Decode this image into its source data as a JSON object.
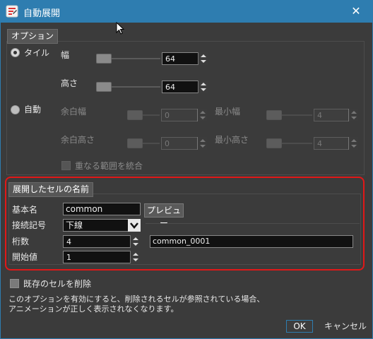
{
  "window": {
    "title": "自動展開",
    "close_glyph": "✕"
  },
  "options": {
    "section_label": "オプション",
    "tile": {
      "radio_label": "タイル",
      "width_label": "幅",
      "width_value": "64",
      "height_label": "高さ",
      "height_value": "64"
    },
    "auto": {
      "radio_label": "自動",
      "margin_width_label": "余白幅",
      "margin_width_value": "0",
      "min_width_label": "最小幅",
      "min_width_value": "4",
      "margin_height_label": "余白高さ",
      "margin_height_value": "0",
      "min_height_label": "最小高さ",
      "min_height_value": "4",
      "merge_label": "重なる範囲を統合"
    }
  },
  "cell_name": {
    "section_label": "展開したセルの名前",
    "base_name_label": "基本名",
    "base_name_value": "common",
    "preview_button": "プレビュー",
    "connector_label": "接続記号",
    "connector_value": "下線",
    "digits_label": "桁数",
    "digits_value": "4",
    "start_label": "開始値",
    "start_value": "1",
    "preview_value": "common_0001"
  },
  "footer": {
    "delete_existing_label": "既存のセルを削除",
    "note_line1": "このオプションを有効にすると、削除されるセルが参照されている場合、",
    "note_line2": "アニメーションが正しく表示されなくなります。",
    "ok": "OK",
    "cancel": "キャンセル"
  }
}
